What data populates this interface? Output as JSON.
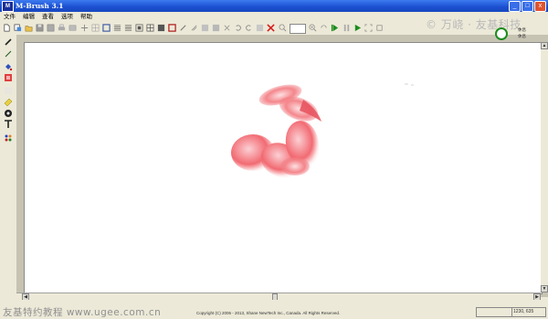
{
  "window": {
    "title": "M-Brush 3.1",
    "icon": "M-Brush app icon"
  },
  "window_buttons": [
    "_",
    "□",
    "x"
  ],
  "menu": [
    "文件",
    "编辑",
    "查看",
    "选项",
    "帮助"
  ],
  "watermark_top": "© 万峣 · 友基科技",
  "mini_panel": {
    "label_1": "休息",
    "label_2": "休息"
  },
  "status": {
    "copyright": "Copyright (C) 2006 - 2013, Shane NewTech Inc., Canada.  All Rights Reserved.",
    "coords": "1230, 635"
  },
  "watermark_bottom": "友基特约教程  www.ugee.com.cn",
  "colors": {
    "petal": "#f07a80",
    "accent_green": "#1c8c1c",
    "close_red": "#d42020"
  }
}
